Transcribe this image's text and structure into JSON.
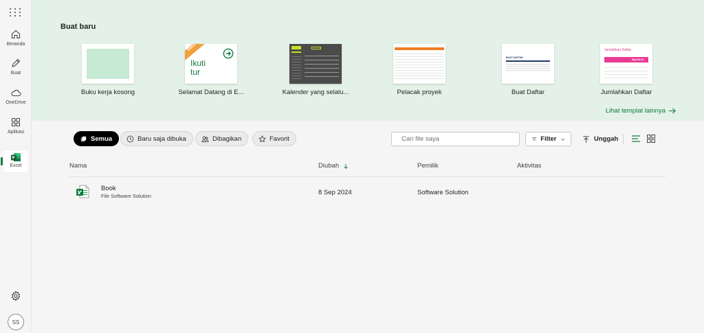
{
  "rail": {
    "items": [
      {
        "label": "Beranda",
        "icon": "home-icon"
      },
      {
        "label": "Buat",
        "icon": "pencil-icon"
      },
      {
        "label": "OneDrive",
        "icon": "cloud-icon"
      },
      {
        "label": "Aplikasi",
        "icon": "apps-icon"
      }
    ],
    "active": {
      "label": "Excel",
      "icon": "excel-icon"
    },
    "avatar_initials": "SS",
    "accent_color": "#107c41"
  },
  "create": {
    "title": "Buat baru",
    "templates": [
      {
        "label": "Buku kerja kosong"
      },
      {
        "label": "Selamat Datang di E...",
        "badge": "Baru",
        "thumb_text": "Ikuti tur"
      },
      {
        "label": "Kalender yang selalu..."
      },
      {
        "label": "Pelacak proyek"
      },
      {
        "label": "Buat Daftar",
        "thumb_text": "BUAT DAFTAR"
      },
      {
        "label": "Jumlahkan Daftar",
        "thumb_text": "Jumlahkan Daftar",
        "thumb_value": "Rp136.02"
      }
    ],
    "see_more": "Lihat templat lainnya"
  },
  "filters": {
    "tabs": [
      {
        "label": "Semua",
        "icon": "stack-icon"
      },
      {
        "label": "Baru saja dibuka",
        "icon": "clock-icon"
      },
      {
        "label": "Dibagikan",
        "icon": "people-icon"
      },
      {
        "label": "Favorit",
        "icon": "star-icon"
      }
    ],
    "search_placeholder": "Cari file saya",
    "filter_label": "Filter",
    "upload_label": "Unggah"
  },
  "table": {
    "columns": [
      "Nama",
      "Diubah",
      "Pemilik",
      "Aktivitas"
    ],
    "rows": [
      {
        "name": "Book",
        "location": "File Software Solution",
        "modified": "8 Sep 2024",
        "owner": "Software Solution",
        "activity": ""
      }
    ]
  }
}
